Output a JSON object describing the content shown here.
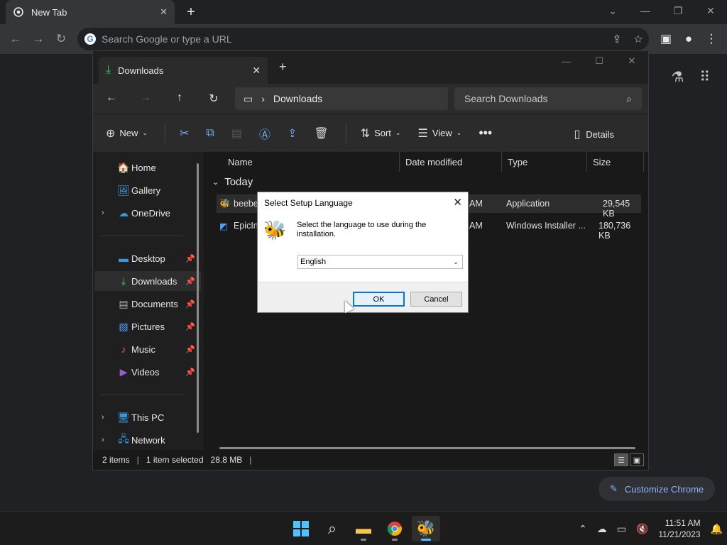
{
  "chrome": {
    "tab_title": "New Tab",
    "tab_close": "✕",
    "new_tab": "+",
    "omnibox_placeholder": "Search Google or type a URL",
    "customize_label": "Customize Chrome"
  },
  "explorer": {
    "tab_title": "Downloads",
    "breadcrumb": "Downloads",
    "search_placeholder": "Search Downloads",
    "commands": {
      "new": "New",
      "sort": "Sort",
      "view": "View",
      "details": "Details"
    },
    "sidebar": {
      "home": "Home",
      "gallery": "Gallery",
      "onedrive": "OneDrive",
      "desktop": "Desktop",
      "downloads": "Downloads",
      "documents": "Documents",
      "pictures": "Pictures",
      "music": "Music",
      "videos": "Videos",
      "this_pc": "This PC",
      "network": "Network"
    },
    "columns": {
      "name": "Name",
      "date": "Date modified",
      "type": "Type",
      "size": "Size"
    },
    "group": "Today",
    "files": [
      {
        "name": "beebe",
        "date": "AM",
        "type": "Application",
        "size": "29,545 KB"
      },
      {
        "name": "EpicIns",
        "date": "AM",
        "type": "Windows Installer ...",
        "size": "180,736 KB"
      }
    ],
    "status": {
      "items": "2 items",
      "selected": "1 item selected",
      "size": "28.8 MB"
    }
  },
  "dialog": {
    "title": "Select Setup Language",
    "message": "Select the language to use during the installation.",
    "language": "English",
    "ok": "OK",
    "cancel": "Cancel"
  },
  "taskbar": {
    "time": "11:51 AM",
    "date": "11/21/2023"
  },
  "colors": {
    "accent": "#4cc2ff",
    "dialog_primary_border": "#0078d7",
    "link": "#8ab4f8"
  }
}
